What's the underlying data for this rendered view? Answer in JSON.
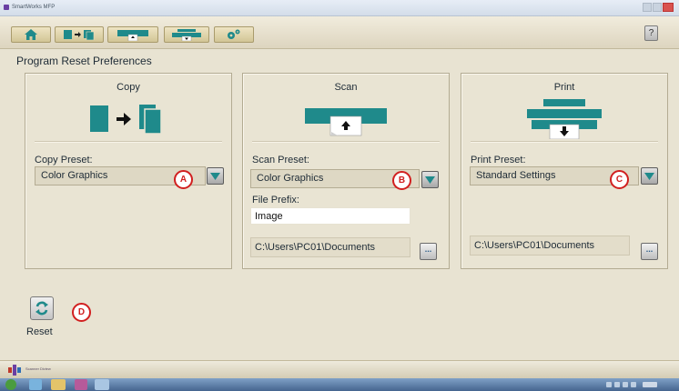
{
  "window": {
    "title": "SmartWorks MFP"
  },
  "toolbar": {
    "buttons": [
      {
        "name": "home",
        "icon": "home-icon"
      },
      {
        "name": "copy",
        "icon": "copy-icon"
      },
      {
        "name": "scan",
        "icon": "scan-icon"
      },
      {
        "name": "print",
        "icon": "print-icon"
      },
      {
        "name": "settings",
        "icon": "gears-icon"
      }
    ],
    "help_label": "?"
  },
  "page": {
    "title": "Program Reset Preferences"
  },
  "copy": {
    "title": "Copy",
    "preset_label": "Copy Preset:",
    "preset_value": "Color Graphics",
    "callout": "A"
  },
  "scan": {
    "title": "Scan",
    "preset_label": "Scan Preset:",
    "preset_value": "Color Graphics",
    "callout": "B",
    "file_prefix_label": "File Prefix:",
    "file_prefix_value": "Image",
    "path": "C:\\Users\\PC01\\Documents",
    "browse_label": "..."
  },
  "print": {
    "title": "Print",
    "preset_label": "Print Preset:",
    "preset_value": "Standard Settings",
    "callout": "C",
    "path": "C:\\Users\\PC01\\Documents",
    "browse_label": "..."
  },
  "reset": {
    "label": "Reset",
    "callout": "D"
  },
  "footer": {
    "brand": "Scanner Diview"
  },
  "colors": {
    "accent_teal": "#1f8a8b",
    "callout_red": "#d11f1f",
    "panel_bg": "#e9e4d3"
  }
}
